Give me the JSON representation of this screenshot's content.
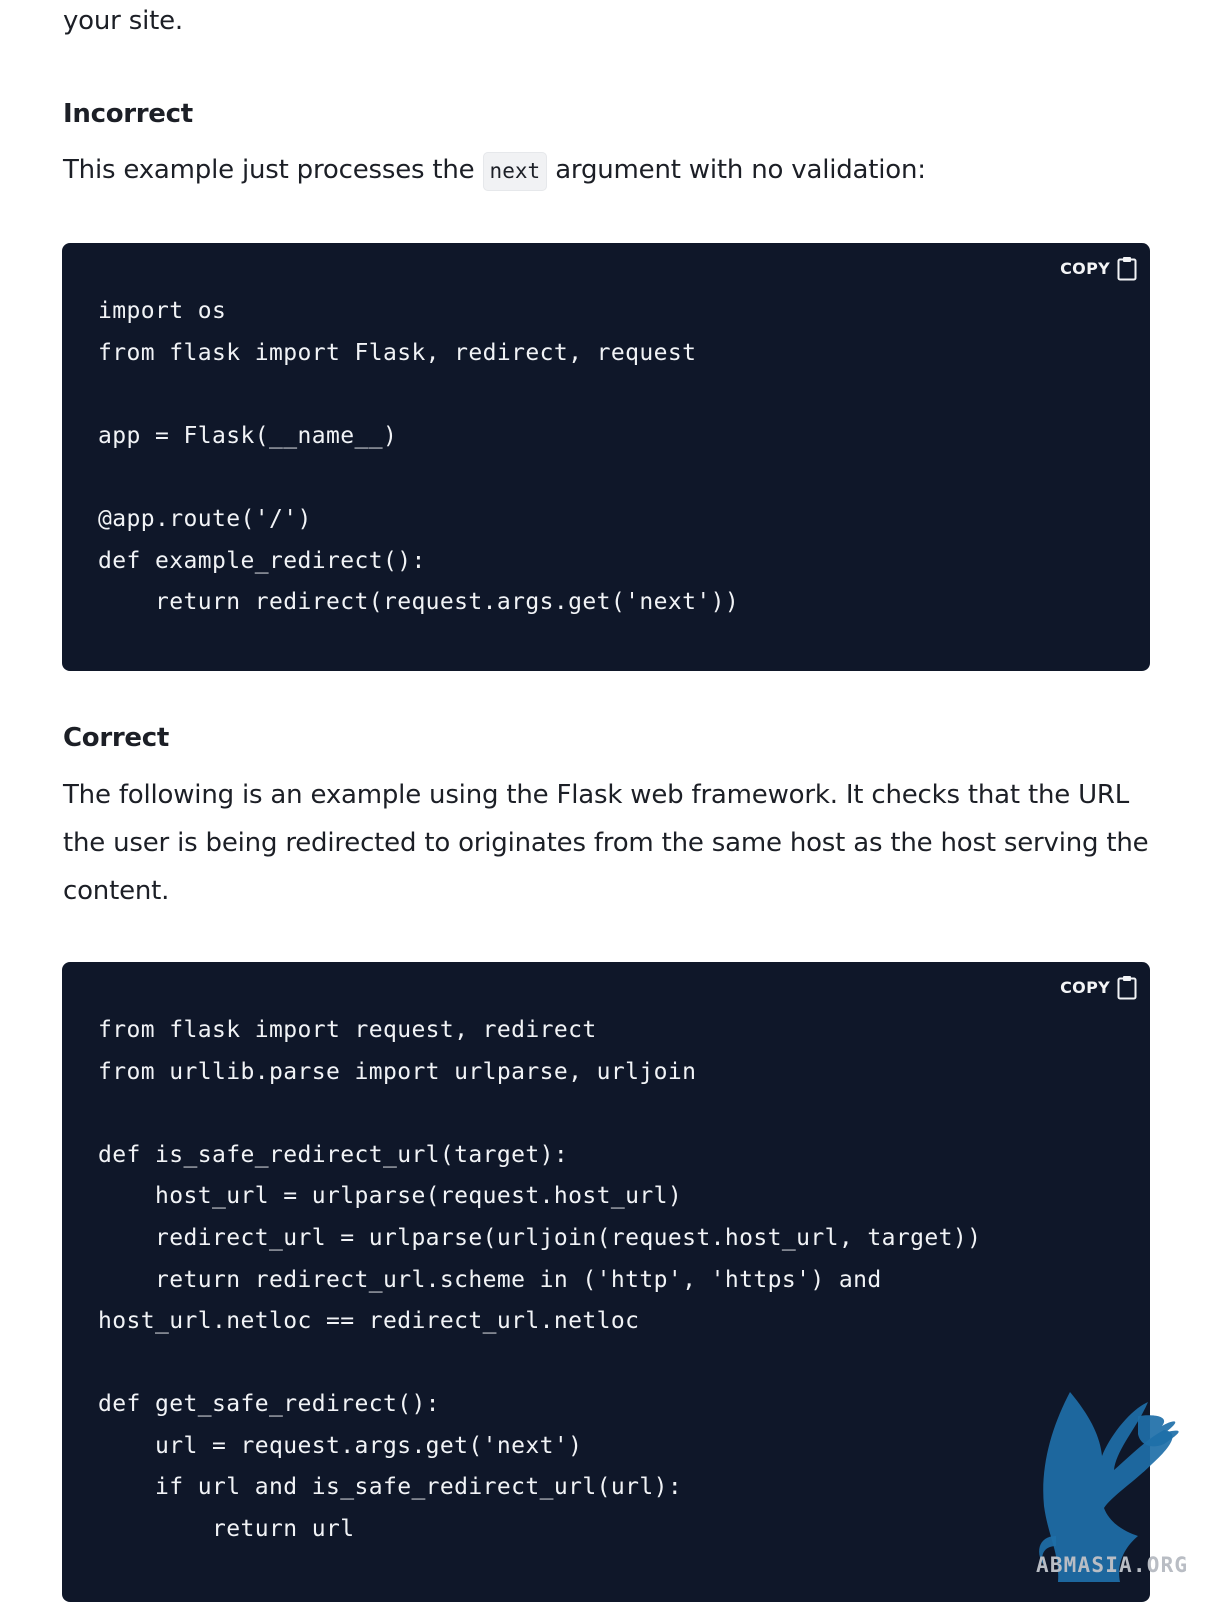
{
  "intro_tail": "your site.",
  "incorrect": {
    "heading": "Incorrect",
    "text_before": "This example just processes the",
    "inline_code": "next",
    "text_after": "argument with no validation:",
    "code": {
      "copy_label": "COPY",
      "lines": [
        "import os",
        "from flask import Flask, redirect, request",
        "",
        "app = Flask(__name__)",
        "",
        "@app.route('/')",
        "def example_redirect():",
        "    return redirect(request.args.get('next'))"
      ]
    }
  },
  "correct": {
    "heading": "Correct",
    "paragraph": "The following is an example using the Flask web framework. It checks that the URL the user is being redirected to originates from the same host as the host serving the content.",
    "code": {
      "copy_label": "COPY",
      "lines": [
        "from flask import request, redirect",
        "from urllib.parse import urlparse, urljoin",
        "",
        "def is_safe_redirect_url(target):",
        "    host_url = urlparse(request.host_url)",
        "    redirect_url = urlparse(urljoin(request.host_url, target))",
        "    return redirect_url.scheme in ('http', 'https') and",
        "host_url.netloc == redirect_url.netloc",
        "",
        "def get_safe_redirect():",
        "    url = request.args.get('next')",
        "    if url and is_safe_redirect_url(url):",
        "        return url"
      ]
    }
  },
  "watermark": {
    "text": "ABMASIA.ORG",
    "color": "#1e6fa8"
  },
  "colors": {
    "code_background": "#0f1729",
    "code_text": "#f1f3f6",
    "body_text": "#1c1f26"
  }
}
